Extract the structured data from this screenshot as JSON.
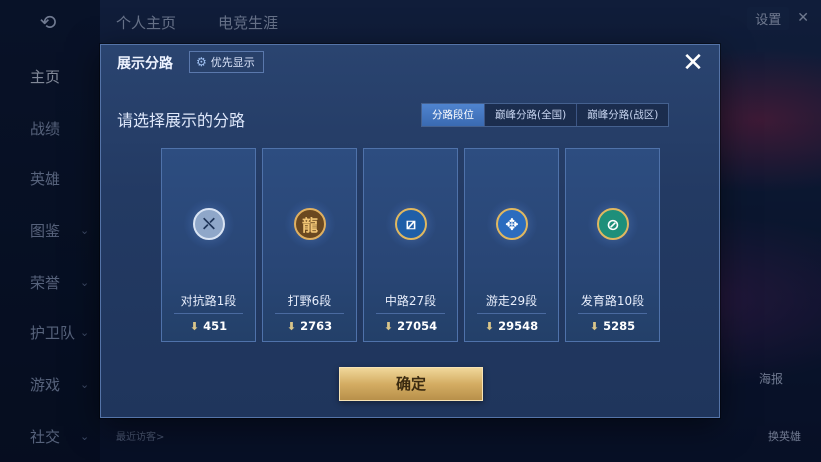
{
  "background": {
    "top_tabs": [
      "个人主页",
      "电竞生涯"
    ],
    "sidebar": [
      {
        "label": "主页",
        "active": true
      },
      {
        "label": "战绩"
      },
      {
        "label": "英雄"
      },
      {
        "label": "图鉴",
        "chevron": "⌄"
      },
      {
        "label": "荣誉",
        "chevron": "⌄"
      },
      {
        "label": "护卫队",
        "chevron": "⌄"
      },
      {
        "label": "游戏",
        "chevron": "⌄"
      },
      {
        "label": "社交",
        "chevron": "⌄"
      }
    ],
    "settings_label": "设置",
    "recent_visitors": "最近访客>",
    "side_badge": "海报",
    "side_badge2": "换英雄"
  },
  "modal": {
    "title": "展示分路",
    "priority_label": "优先显示",
    "subtitle": "请选择展示的分路",
    "tabs": [
      {
        "label": "分路段位",
        "active": true
      },
      {
        "label": "巅峰分路(全国)"
      },
      {
        "label": "巅峰分路(战区)"
      }
    ],
    "cards": [
      {
        "name": "对抗路1段",
        "score": "451",
        "emblem_icon": "clash-lane-icon",
        "emblem_color": "#c8d6ec"
      },
      {
        "name": "打野6段",
        "score": "2763",
        "emblem_icon": "jungle-dragon-icon",
        "emblem_color": "#d8a24c"
      },
      {
        "name": "中路27段",
        "score": "27054",
        "emblem_icon": "mid-lane-icon",
        "emblem_color": "#5fa8ef"
      },
      {
        "name": "游走29段",
        "score": "29548",
        "emblem_icon": "roam-wings-icon",
        "emblem_color": "#7fb6f0"
      },
      {
        "name": "发育路10段",
        "score": "5285",
        "emblem_icon": "farm-lane-icon",
        "emblem_color": "#4fc7a8"
      }
    ],
    "confirm_label": "确定"
  },
  "colors": {
    "accent_blue": "#3a6ab2",
    "gold_button": "#d4ad63"
  }
}
